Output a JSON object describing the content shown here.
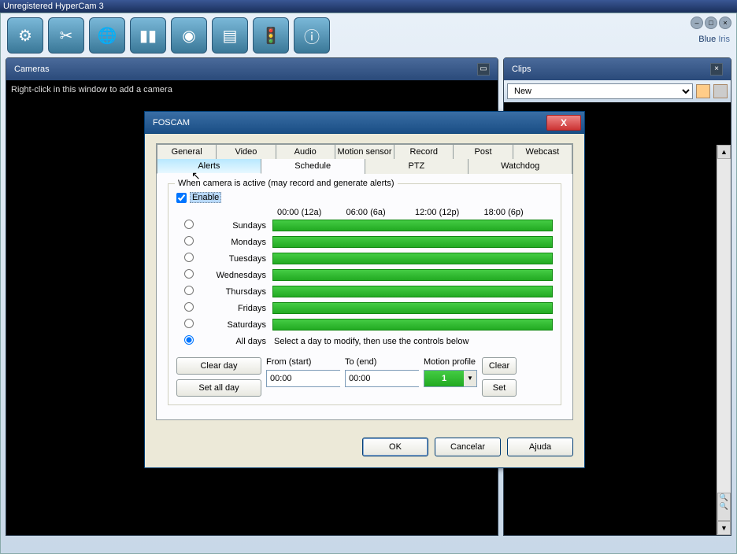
{
  "titlebar": "Unregistered HyperCam 3",
  "logo": {
    "part1": "Blue",
    "part2": " Iris"
  },
  "panels": {
    "cameras": {
      "title": "Cameras",
      "hint": "Right-click in this window to add a camera"
    },
    "clips": {
      "title": "Clips",
      "select": "New"
    }
  },
  "dialog": {
    "title": "FOSCAM",
    "tabs_top": [
      "General",
      "Video",
      "Audio",
      "Motion sensor",
      "Record",
      "Post",
      "Webcast"
    ],
    "tabs_bot": [
      "Alerts",
      "Schedule",
      "PTZ",
      "Watchdog"
    ],
    "legend": "When camera is active (may record and generate alerts)",
    "enable": "Enable",
    "time_headers": [
      "00:00 (12a)",
      "06:00 (6a)",
      "12:00 (12p)",
      "18:00 (6p)"
    ],
    "days": [
      "Sundays",
      "Mondays",
      "Tuesdays",
      "Wednesdays",
      "Thursdays",
      "Fridays",
      "Saturdays",
      "All days"
    ],
    "all_days_hint": "Select a day to modify, then use the controls below",
    "clear_day": "Clear day",
    "set_all_day": "Set all day",
    "from_label": "From (start)",
    "to_label": "To (end)",
    "profile_label": "Motion profile",
    "from_val": "00:00",
    "to_val": "00:00",
    "profile_val": "1",
    "clear": "Clear",
    "set": "Set",
    "ok": "OK",
    "cancel": "Cancelar",
    "help": "Ajuda"
  }
}
